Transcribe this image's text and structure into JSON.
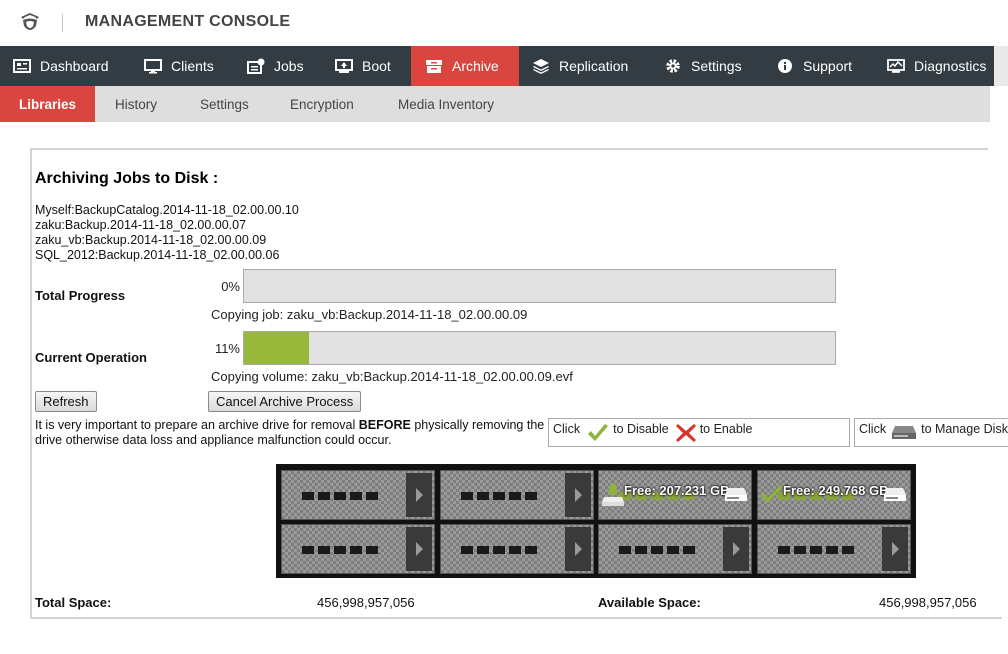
{
  "header": {
    "title": "MANAGEMENT CONSOLE",
    "logo": "shield-logo"
  },
  "main_nav": {
    "items": [
      {
        "label": "Dashboard",
        "icon": "dashboard-icon"
      },
      {
        "label": "Clients",
        "icon": "monitor-icon"
      },
      {
        "label": "Jobs",
        "icon": "jobs-icon"
      },
      {
        "label": "Boot",
        "icon": "boot-icon"
      },
      {
        "label": "Archive",
        "icon": "archive-icon",
        "active": true
      },
      {
        "label": "Replication",
        "icon": "layers-icon"
      },
      {
        "label": "Settings",
        "icon": "gear-icon"
      },
      {
        "label": "Support",
        "icon": "info-icon"
      },
      {
        "label": "Diagnostics",
        "icon": "diagnostics-icon"
      }
    ],
    "accent_color": "#d9463f",
    "bar_color": "#333c42"
  },
  "sub_nav": {
    "items": [
      {
        "label": "Libraries",
        "active": true
      },
      {
        "label": "History"
      },
      {
        "label": "Settings"
      },
      {
        "label": "Encryption"
      },
      {
        "label": "Media Inventory"
      }
    ]
  },
  "archive": {
    "title": "Archiving Jobs to Disk :",
    "jobs": [
      "Myself:BackupCatalog.2014-11-18_02.00.00.10",
      "zaku:Backup.2014-11-18_02.00.00.07",
      "zaku_vb:Backup.2014-11-18_02.00.00.09",
      "SQL_2012:Backup.2014-11-18_02.00.00.06"
    ],
    "total_progress": {
      "label": "Total Progress",
      "percent_text": "0%",
      "fraction": 0.0,
      "caption": "Copying job: zaku_vb:Backup.2014-11-18_02.00.00.09"
    },
    "current_operation": {
      "label": "Current Operation",
      "percent_text": "11%",
      "fraction": 0.11,
      "caption": "Copying volume: zaku_vb:Backup.2014-11-18_02.00.00.09.evf",
      "fill_color": "#98b83b"
    },
    "refresh_label": "Refresh",
    "cancel_label": "Cancel Archive Process",
    "notice_pre": "It is very important to prepare an archive drive for removal ",
    "notice_bold": "BEFORE",
    "notice_post": " physically removing the drive otherwise data loss and appliance malfunction could occur.",
    "legend_click": "Click",
    "legend_disable": "to Disable",
    "legend_enable": "to Enable",
    "legend_manage_click": "Click",
    "legend_manage": "to Manage Disk"
  },
  "disks": {
    "slots": [
      {
        "state": "empty"
      },
      {
        "state": "empty"
      },
      {
        "state": "disabled",
        "free": "Free: 207.231 GB"
      },
      {
        "state": "enabled",
        "free": "Free: 249.768 GB"
      },
      {
        "state": "empty"
      },
      {
        "state": "empty"
      },
      {
        "state": "empty"
      },
      {
        "state": "empty"
      }
    ]
  },
  "totals": {
    "total_label": "Total Space:",
    "total_value": "456,998,957,056",
    "available_label": "Available Space:",
    "available_value": "456,998,957,056"
  }
}
